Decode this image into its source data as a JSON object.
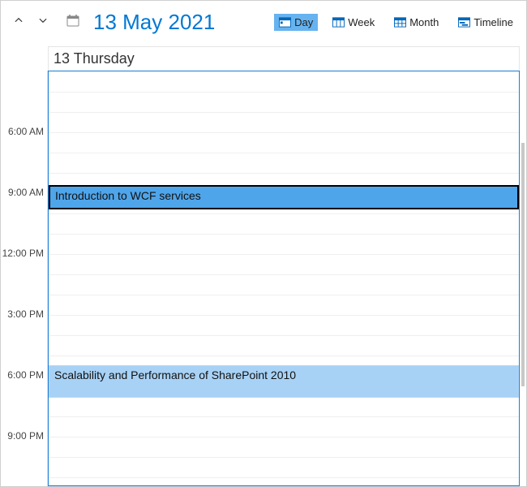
{
  "toolbar": {
    "date_title": "13 May 2021",
    "views": {
      "day": "Day",
      "week": "Week",
      "month": "Month",
      "timeline": "Timeline"
    },
    "active_view": "day"
  },
  "day_header": "13 Thursday",
  "time_labels": [
    "6:00 AM",
    "9:00 AM",
    "12:00 PM",
    "3:00 PM",
    "6:00 PM",
    "9:00 PM"
  ],
  "appointments": [
    {
      "title": "Introduction to WCF services",
      "selected": true
    },
    {
      "title": "Scalability and Performance of SharePoint 2010",
      "selected": false
    }
  ]
}
